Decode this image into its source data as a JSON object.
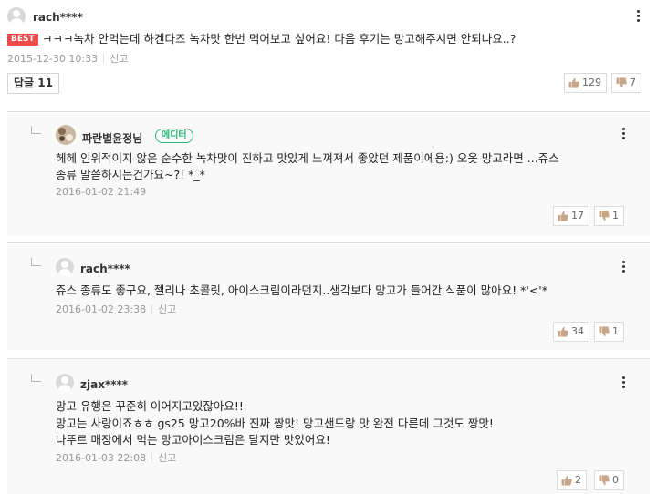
{
  "top_comment": {
    "username": "rach****",
    "badge": "BEST",
    "text": "ㅋㅋㅋ녹차 안먹는데 하겐다즈 녹차맛 한번 먹어보고 싶어요! 다음 후기는 망고해주시면 안되나요..?",
    "timestamp": "2015-12-30 10:33",
    "report_label": "신고",
    "reply_button_label": "답글",
    "reply_count": "11",
    "likes": "129",
    "dislikes": "7"
  },
  "replies": [
    {
      "username": "파란별윤정님",
      "badge": "에디터",
      "lines": [
        "헤헤 인위적이지 않은 순수한 녹차맛이 진하고 맛있게 느껴져서 좋았던 제품이에용:) 오옷 망고라면 ...쥬스",
        "종류 말씀하시는건가요~?! *_*"
      ],
      "timestamp": "2016-01-02 21:49",
      "likes": "17",
      "dislikes": "1"
    },
    {
      "username": "rach****",
      "lines": [
        "쥬스 종류도 좋구요, 젤리나 초콜릿, 아이스크림이라던지..생각보다 망고가 들어간 식품이 많아요! *'<'*"
      ],
      "timestamp": "2016-01-02 23:38",
      "report_label": "신고",
      "likes": "34",
      "dislikes": "1"
    },
    {
      "username": "zjax****",
      "lines": [
        "망고 유행은 꾸준히 이어지고있잖아요!!",
        "망고는 사랑이죠ㅎㅎ gs25 망고20%바 진짜 짱맛! 망고샌드랑 맛 완전 다른데 그것도 짱맛!",
        "나뚜르 매장에서 먹는 망고아이스크림은 달지만 맛있어요!"
      ],
      "timestamp": "2016-01-03 22:08",
      "report_label": "신고",
      "likes": "2",
      "dislikes": "0"
    }
  ],
  "icons": {
    "like": "thumbs-up-icon",
    "dislike": "thumbs-down-icon",
    "more": "more-vertical-icon",
    "avatar": "default-user-avatar-icon"
  },
  "colors": {
    "best_badge": "#f04b4b",
    "editor_badge": "#2cb87a",
    "thumb_icon": "#c8a68a"
  }
}
